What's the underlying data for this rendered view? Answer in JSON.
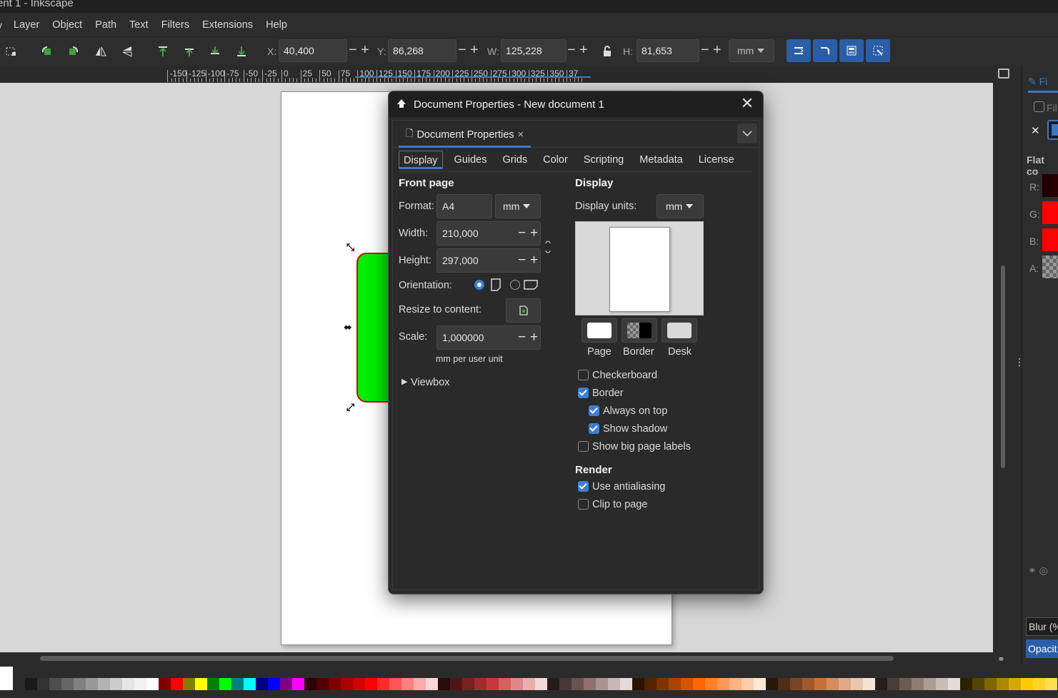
{
  "window": {
    "title": "ent 1 - Inkscape"
  },
  "menu": [
    "Layer",
    "Object",
    "Path",
    "Text",
    "Filters",
    "Extensions",
    "Help"
  ],
  "toolbar": {
    "x_label": "X:",
    "x_value": "40,400",
    "y_label": "Y:",
    "y_value": "86,268",
    "w_label": "W:",
    "w_value": "125,228",
    "h_label": "H:",
    "h_value": "81,653",
    "unit": "mm",
    "minus": "−",
    "plus": "+"
  },
  "ruler": [
    "-150",
    "-125",
    "-100",
    "-75",
    "-50",
    "-25",
    "0",
    "25",
    "50",
    "75",
    "100",
    "125",
    "150",
    "175",
    "200",
    "225",
    "250",
    "275",
    "300",
    "325",
    "350",
    "37"
  ],
  "dialog": {
    "title": "Document Properties - New document 1",
    "tab_label": "Document Properties",
    "tab_close": "×",
    "subtabs": [
      "Display",
      "Guides",
      "Grids",
      "Color",
      "Scripting",
      "Metadata",
      "License"
    ],
    "front_page": {
      "heading": "Front page",
      "format_label": "Format:",
      "format_value": "A4",
      "format_unit": "mm",
      "width_label": "Width:",
      "width_value": "210,000",
      "height_label": "Height:",
      "height_value": "297,000",
      "orientation_label": "Orientation:",
      "resize_label": "Resize to content:",
      "scale_label": "Scale:",
      "scale_value": "1,000000",
      "scale_unit_note": "mm per user unit",
      "viewbox_label": "Viewbox"
    },
    "display": {
      "heading": "Display",
      "units_label": "Display units:",
      "units_value": "mm",
      "color_labels": [
        "Page",
        "Border",
        "Desk"
      ],
      "checkboxes": [
        {
          "label": "Checkerboard",
          "checked": false
        },
        {
          "label": "Border",
          "checked": true
        },
        {
          "label": "Always on top",
          "checked": true
        },
        {
          "label": "Show shadow",
          "checked": true
        },
        {
          "label": "Show big page labels",
          "checked": false
        }
      ]
    },
    "render": {
      "heading": "Render",
      "checkboxes": [
        {
          "label": "Use antialiasing",
          "checked": true
        },
        {
          "label": "Clip to page",
          "checked": false
        }
      ]
    }
  },
  "right_panel": {
    "tab_label": "Fi",
    "fill_label": "Fil",
    "flat_label": "Flat co",
    "channels": [
      "R:",
      "G:",
      "B:",
      "A:"
    ],
    "blur_label": "Blur (%",
    "opacity_label": "Opacit"
  },
  "colors": {
    "accent": "#3d78c8",
    "object_fill": "#00ee00",
    "object_stroke": "#d80000"
  },
  "palette": [
    "#ffffff",
    "#1a1a1a",
    "#333333",
    "#4d4d4d",
    "#666666",
    "#808080",
    "#999999",
    "#b3b3b3",
    "#cccccc",
    "#e6e6e6",
    "#f2f2f2",
    "#ffffff",
    "#800000",
    "#ff0000",
    "#808000",
    "#ffff00",
    "#008000",
    "#00ff00",
    "#008080",
    "#00ffff",
    "#000080",
    "#0000ff",
    "#800080",
    "#ff00ff",
    "#2b0000",
    "#550000",
    "#800000",
    "#aa0000",
    "#d40000",
    "#ff0000",
    "#ff2a2a",
    "#ff5555",
    "#ff8080",
    "#ffaaaa",
    "#ffd5d5",
    "#280b0b",
    "#501616",
    "#782121",
    "#a02c2c",
    "#c83737",
    "#d35f5f",
    "#de8787",
    "#e9afaf",
    "#f4d7d7",
    "#241c1c",
    "#483737",
    "#6c5353",
    "#916f6f",
    "#ac9393",
    "#c8b7b7",
    "#e3dbdb",
    "#2b1100",
    "#552200",
    "#803300",
    "#aa4400",
    "#d45500",
    "#ff6600",
    "#ff7f2a",
    "#ff9955",
    "#ffb380",
    "#ffccaa",
    "#ffe6d5",
    "#28170b",
    "#502d16",
    "#784421",
    "#a05a2c",
    "#c87137",
    "#d38d5f",
    "#deaa87",
    "#e9c6af",
    "#f4e3d7",
    "#241f1c",
    "#483e37",
    "#6c5d53",
    "#917c6f",
    "#ac9d93",
    "#c8beb7",
    "#e3dedb",
    "#2b2200",
    "#554400",
    "#806600",
    "#aa8800",
    "#d4aa00",
    "#ffcc00",
    "#ffd42a",
    "#ffdd55"
  ]
}
